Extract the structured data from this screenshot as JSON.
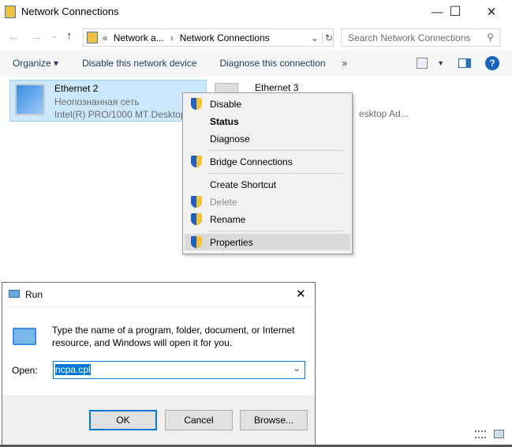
{
  "window": {
    "title": "Network Connections",
    "minimize": "—",
    "maximize": "☐",
    "close": "✕"
  },
  "address": {
    "prefix": "«",
    "crumbs": [
      "Network a...",
      "Network Connections"
    ],
    "separator": "›"
  },
  "search": {
    "placeholder": "Search Network Connections"
  },
  "toolbar": {
    "organize": "Organize ▾",
    "disable": "Disable this network device",
    "diagnose": "Diagnose this connection",
    "more": "»"
  },
  "connections": [
    {
      "name": "Ethernet 2",
      "status": "Неопознанная сеть",
      "device": "Intel(R) PRO/1000 MT Desktop"
    },
    {
      "name": "Ethernet 3",
      "status": "",
      "device": "esktop Ad..."
    }
  ],
  "context_menu": {
    "items": [
      {
        "label": "Disable",
        "shield": true
      },
      {
        "label": "Status",
        "bold": true
      },
      {
        "label": "Diagnose"
      },
      {
        "label": "Bridge Connections",
        "shield": true
      },
      {
        "label": "Create Shortcut"
      },
      {
        "label": "Delete",
        "shield": true,
        "disabled": true
      },
      {
        "label": "Rename",
        "shield": true
      },
      {
        "label": "Properties",
        "shield": true,
        "highlighted": true
      }
    ]
  },
  "run_dialog": {
    "title": "Run",
    "description": "Type the name of a program, folder, document, or Internet resource, and Windows will open it for you.",
    "open_label": "Open:",
    "value": "ncpa.cpl",
    "ok": "OK",
    "cancel": "Cancel",
    "browse": "Browse..."
  },
  "colors": {
    "accent": "#0078d7",
    "selection": "#cce8ff",
    "help": "#1565c0"
  }
}
